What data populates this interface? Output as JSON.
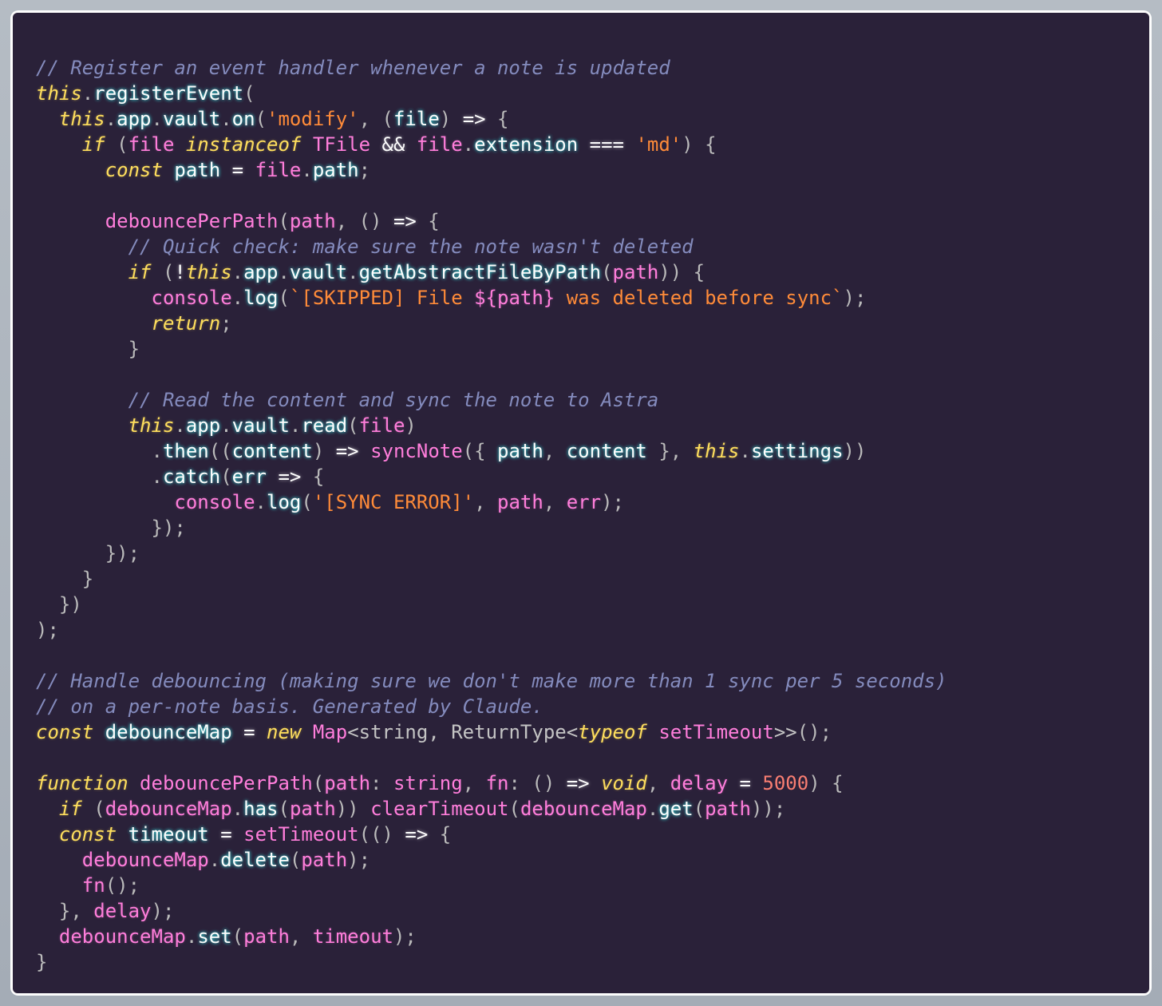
{
  "editor": {
    "language": "typescript",
    "theme": "SynthWave '84",
    "colors": {
      "background": "#2a2139",
      "comment": "#848bbd",
      "keyword": "#fede5d",
      "string": "#ff8b39",
      "variable": "#ff7edb",
      "number": "#f97e72",
      "glow": "#36f9f6"
    },
    "lines": [
      [
        [
          "c",
          "// Register an event handler whenever a note is updated"
        ]
      ],
      [
        [
          "this",
          "this"
        ],
        [
          "p",
          "."
        ],
        [
          "call",
          "registerEvent"
        ],
        [
          "p",
          "("
        ]
      ],
      [
        [
          "p",
          "  "
        ],
        [
          "this",
          "this"
        ],
        [
          "p",
          "."
        ],
        [
          "prop",
          "app"
        ],
        [
          "p",
          "."
        ],
        [
          "prop",
          "vault"
        ],
        [
          "p",
          "."
        ],
        [
          "call",
          "on"
        ],
        [
          "p",
          "("
        ],
        [
          "s",
          "'modify'"
        ],
        [
          "p",
          ", ("
        ],
        [
          "prop",
          "file"
        ],
        [
          "p",
          ") "
        ],
        [
          "o",
          "=>"
        ],
        [
          "p",
          " {"
        ]
      ],
      [
        [
          "p",
          "    "
        ],
        [
          "k",
          "if"
        ],
        [
          "p",
          " ("
        ],
        [
          "v",
          "file"
        ],
        [
          "p",
          " "
        ],
        [
          "k",
          "instanceof"
        ],
        [
          "p",
          " "
        ],
        [
          "t",
          "TFile"
        ],
        [
          "p",
          " "
        ],
        [
          "o",
          "&&"
        ],
        [
          "p",
          " "
        ],
        [
          "v",
          "file"
        ],
        [
          "p",
          "."
        ],
        [
          "prop",
          "extension"
        ],
        [
          "p",
          " "
        ],
        [
          "o",
          "==="
        ],
        [
          "p",
          " "
        ],
        [
          "s",
          "'md'"
        ],
        [
          "p",
          ") {"
        ]
      ],
      [
        [
          "p",
          "      "
        ],
        [
          "k",
          "const"
        ],
        [
          "p",
          " "
        ],
        [
          "prop",
          "path"
        ],
        [
          "p",
          " "
        ],
        [
          "o",
          "="
        ],
        [
          "p",
          " "
        ],
        [
          "v",
          "file"
        ],
        [
          "p",
          "."
        ],
        [
          "prop",
          "path"
        ],
        [
          "p",
          ";"
        ]
      ],
      [],
      [
        [
          "p",
          "      "
        ],
        [
          "f",
          "debouncePerPath"
        ],
        [
          "p",
          "("
        ],
        [
          "v",
          "path"
        ],
        [
          "p",
          ", () "
        ],
        [
          "o",
          "=>"
        ],
        [
          "p",
          " {"
        ]
      ],
      [
        [
          "p",
          "        "
        ],
        [
          "c",
          "// Quick check: make sure the note wasn't deleted"
        ]
      ],
      [
        [
          "p",
          "        "
        ],
        [
          "k",
          "if"
        ],
        [
          "p",
          " ("
        ],
        [
          "o",
          "!"
        ],
        [
          "this",
          "this"
        ],
        [
          "p",
          "."
        ],
        [
          "prop",
          "app"
        ],
        [
          "p",
          "."
        ],
        [
          "prop",
          "vault"
        ],
        [
          "p",
          "."
        ],
        [
          "call",
          "getAbstractFileByPath"
        ],
        [
          "p",
          "("
        ],
        [
          "v",
          "path"
        ],
        [
          "p",
          ")) {"
        ]
      ],
      [
        [
          "p",
          "          "
        ],
        [
          "v",
          "console"
        ],
        [
          "p",
          "."
        ],
        [
          "call",
          "log"
        ],
        [
          "p",
          "("
        ],
        [
          "s",
          "`[SKIPPED] File "
        ],
        [
          "v",
          "${path}"
        ],
        [
          "s",
          " was deleted before sync`"
        ],
        [
          "p",
          ");"
        ]
      ],
      [
        [
          "p",
          "          "
        ],
        [
          "k",
          "return"
        ],
        [
          "p",
          ";"
        ]
      ],
      [
        [
          "p",
          "        }"
        ]
      ],
      [],
      [
        [
          "p",
          "        "
        ],
        [
          "c",
          "// Read the content and sync the note to Astra"
        ]
      ],
      [
        [
          "p",
          "        "
        ],
        [
          "this",
          "this"
        ],
        [
          "p",
          "."
        ],
        [
          "prop",
          "app"
        ],
        [
          "p",
          "."
        ],
        [
          "prop",
          "vault"
        ],
        [
          "p",
          "."
        ],
        [
          "call",
          "read"
        ],
        [
          "p",
          "("
        ],
        [
          "v",
          "file"
        ],
        [
          "p",
          ")"
        ]
      ],
      [
        [
          "p",
          "          ."
        ],
        [
          "call",
          "then"
        ],
        [
          "p",
          "(("
        ],
        [
          "prop",
          "content"
        ],
        [
          "p",
          ") "
        ],
        [
          "o",
          "=>"
        ],
        [
          "p",
          " "
        ],
        [
          "f",
          "syncNote"
        ],
        [
          "p",
          "({ "
        ],
        [
          "prop",
          "path"
        ],
        [
          "p",
          ", "
        ],
        [
          "prop",
          "content"
        ],
        [
          "p",
          " }, "
        ],
        [
          "this",
          "this"
        ],
        [
          "p",
          "."
        ],
        [
          "prop",
          "settings"
        ],
        [
          "p",
          "))"
        ]
      ],
      [
        [
          "p",
          "          ."
        ],
        [
          "call",
          "catch"
        ],
        [
          "p",
          "("
        ],
        [
          "prop",
          "err"
        ],
        [
          "p",
          " "
        ],
        [
          "o",
          "=>"
        ],
        [
          "p",
          " {"
        ]
      ],
      [
        [
          "p",
          "            "
        ],
        [
          "v",
          "console"
        ],
        [
          "p",
          "."
        ],
        [
          "call",
          "log"
        ],
        [
          "p",
          "("
        ],
        [
          "s",
          "'[SYNC ERROR]'"
        ],
        [
          "p",
          ", "
        ],
        [
          "v",
          "path"
        ],
        [
          "p",
          ", "
        ],
        [
          "v",
          "err"
        ],
        [
          "p",
          ");"
        ]
      ],
      [
        [
          "p",
          "          });"
        ]
      ],
      [
        [
          "p",
          "      });"
        ]
      ],
      [
        [
          "p",
          "    }"
        ]
      ],
      [
        [
          "p",
          "  })"
        ]
      ],
      [
        [
          "p",
          ");"
        ]
      ],
      [],
      [
        [
          "c",
          "// Handle debouncing (making sure we don't make more than 1 sync per 5 seconds)"
        ]
      ],
      [
        [
          "c",
          "// on a per-note basis. Generated by Claude."
        ]
      ],
      [
        [
          "k",
          "const"
        ],
        [
          "p",
          " "
        ],
        [
          "prop",
          "debounceMap"
        ],
        [
          "p",
          " "
        ],
        [
          "o",
          "="
        ],
        [
          "p",
          " "
        ],
        [
          "k",
          "new"
        ],
        [
          "p",
          " "
        ],
        [
          "t",
          "Map"
        ],
        [
          "y",
          "<string, ReturnType<"
        ],
        [
          "k",
          "typeof"
        ],
        [
          "p",
          " "
        ],
        [
          "t",
          "setTimeout"
        ],
        [
          "y",
          ">>"
        ],
        [
          "p",
          "();"
        ]
      ],
      [],
      [
        [
          "k",
          "function"
        ],
        [
          "p",
          " "
        ],
        [
          "f",
          "debouncePerPath"
        ],
        [
          "p",
          "("
        ],
        [
          "v",
          "path"
        ],
        [
          "p",
          ": "
        ],
        [
          "t",
          "string"
        ],
        [
          "p",
          ", "
        ],
        [
          "v",
          "fn"
        ],
        [
          "p",
          ": () "
        ],
        [
          "o",
          "=>"
        ],
        [
          "p",
          " "
        ],
        [
          "k",
          "void"
        ],
        [
          "p",
          ", "
        ],
        [
          "v",
          "delay"
        ],
        [
          "p",
          " "
        ],
        [
          "o",
          "="
        ],
        [
          "p",
          " "
        ],
        [
          "n",
          "5000"
        ],
        [
          "p",
          ") {"
        ]
      ],
      [
        [
          "p",
          "  "
        ],
        [
          "k",
          "if"
        ],
        [
          "p",
          " ("
        ],
        [
          "v",
          "debounceMap"
        ],
        [
          "p",
          "."
        ],
        [
          "call",
          "has"
        ],
        [
          "p",
          "("
        ],
        [
          "v",
          "path"
        ],
        [
          "p",
          ")) "
        ],
        [
          "f",
          "clearTimeout"
        ],
        [
          "p",
          "("
        ],
        [
          "v",
          "debounceMap"
        ],
        [
          "p",
          "."
        ],
        [
          "call",
          "get"
        ],
        [
          "p",
          "("
        ],
        [
          "v",
          "path"
        ],
        [
          "p",
          "));"
        ]
      ],
      [
        [
          "p",
          "  "
        ],
        [
          "k",
          "const"
        ],
        [
          "p",
          " "
        ],
        [
          "prop",
          "timeout"
        ],
        [
          "p",
          " "
        ],
        [
          "o",
          "="
        ],
        [
          "p",
          " "
        ],
        [
          "f",
          "setTimeout"
        ],
        [
          "p",
          "(() "
        ],
        [
          "o",
          "=>"
        ],
        [
          "p",
          " {"
        ]
      ],
      [
        [
          "p",
          "    "
        ],
        [
          "v",
          "debounceMap"
        ],
        [
          "p",
          "."
        ],
        [
          "call",
          "delete"
        ],
        [
          "p",
          "("
        ],
        [
          "v",
          "path"
        ],
        [
          "p",
          ");"
        ]
      ],
      [
        [
          "p",
          "    "
        ],
        [
          "v",
          "fn"
        ],
        [
          "p",
          "();"
        ]
      ],
      [
        [
          "p",
          "  }, "
        ],
        [
          "v",
          "delay"
        ],
        [
          "p",
          ");"
        ]
      ],
      [
        [
          "p",
          "  "
        ],
        [
          "v",
          "debounceMap"
        ],
        [
          "p",
          "."
        ],
        [
          "call",
          "set"
        ],
        [
          "p",
          "("
        ],
        [
          "v",
          "path"
        ],
        [
          "p",
          ", "
        ],
        [
          "v",
          "timeout"
        ],
        [
          "p",
          ");"
        ]
      ],
      [
        [
          "p",
          "}"
        ]
      ]
    ]
  }
}
